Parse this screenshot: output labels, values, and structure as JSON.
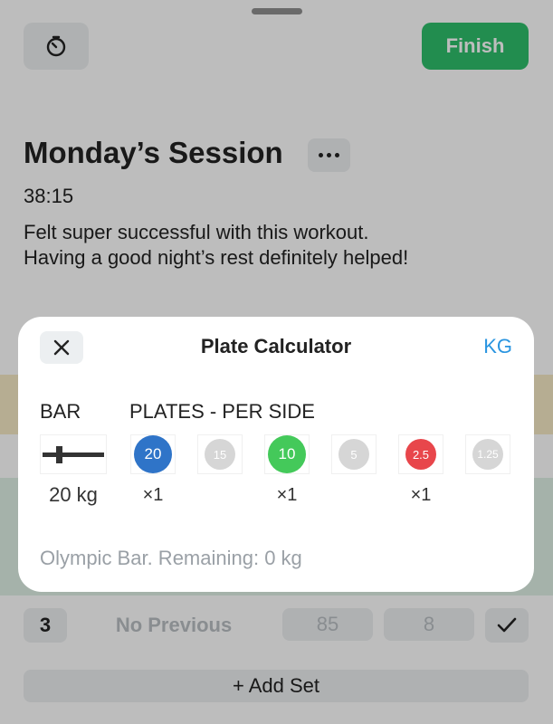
{
  "header": {
    "timer_icon": "timer-icon",
    "finish_label": "Finish"
  },
  "session": {
    "title": "Monday’s Session",
    "duration": "38:15",
    "notes_line1": "Felt super successful with this workout.",
    "notes_line2": "Having a good night’s rest definitely helped!"
  },
  "set_row": {
    "set_number": "3",
    "previous": "No Previous",
    "weight_placeholder": "85",
    "reps_placeholder": "8"
  },
  "add_set_label": "+ Add Set",
  "modal": {
    "title": "Plate Calculator",
    "unit": "KG",
    "bar_header": "BAR",
    "plates_header": "PLATES - PER SIDE",
    "bar_weight": "20 kg",
    "plates": [
      {
        "label": "20",
        "color": "#2f74c8",
        "count": "×1"
      },
      {
        "label": "15",
        "color": "#d6d6d6",
        "count": ""
      },
      {
        "label": "10",
        "color": "#44c95a",
        "count": "×1"
      },
      {
        "label": "5",
        "color": "#d6d6d6",
        "count": ""
      },
      {
        "label": "2.5",
        "color": "#e8464b",
        "count": "×1"
      },
      {
        "label": "1.25",
        "color": "#d6d6d6",
        "count": ""
      }
    ],
    "remaining": "Olympic Bar. Remaining: 0 kg"
  },
  "colors": {
    "accent_green": "#2fbf6b",
    "link_blue": "#2a95e0"
  }
}
